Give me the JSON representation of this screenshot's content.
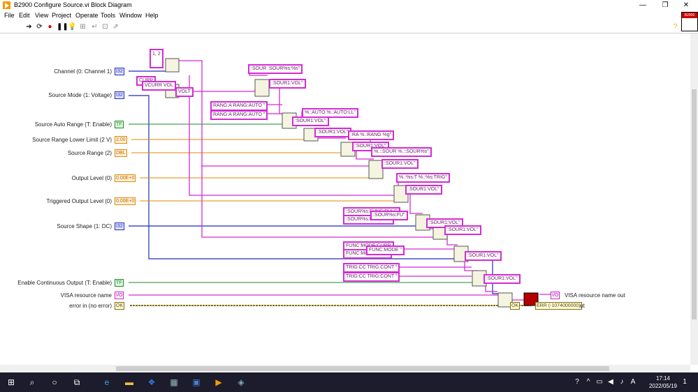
{
  "window": {
    "title": "B2900 Configure Source.vi Block Diagram",
    "minimize": "—",
    "maximize": "❐",
    "close": "✕"
  },
  "menu": [
    "File",
    "Edit",
    "View",
    "Project",
    "Operate",
    "Tools",
    "Window",
    "Help"
  ],
  "inputs": [
    {
      "label": "Channel (0: Channel 1)",
      "value": "I32",
      "color": "blue"
    },
    {
      "label": "Source Mode (1: Voltage)",
      "value": "I32",
      "color": "blue"
    },
    {
      "label": "Source Auto Range (T: Enable)",
      "value": "TF",
      "color": "green"
    },
    {
      "label": "Source Range Lower Limit (2 V)",
      "value": "2.00",
      "color": "orange"
    },
    {
      "label": "Source Range (2)",
      "value": "DBL",
      "color": "orange"
    },
    {
      "label": "Output Level (0)",
      "value": "0.00E+0",
      "color": "orange"
    },
    {
      "label": "Triggered Output Level (0)",
      "value": "0.00E+0",
      "color": "orange"
    },
    {
      "label": "Source Shape (1: DC)",
      "value": "I32",
      "color": "blue"
    },
    {
      "label": "Enable Continuous Output (T: Enable)",
      "value": "TF",
      "color": "green"
    },
    {
      "label": "VISA resource name",
      "value": "I/O",
      "color": "pink"
    },
    {
      "label": "error in (no error)",
      "value": "OK",
      "color": "yellow"
    }
  ],
  "consts": {
    "c12": "1, 2",
    "curr": "CURR",
    "vcurr": "VCURR VOL",
    "volt": "VOLT",
    "sour": ":SOUR :SOUR%s:%s\"",
    "sour1a": ":SOUR1:VOL\"",
    "rang1": "RANG:A RANG:AUTO \"",
    "rang2": "RANG:A RANG:AUTO \"",
    "auto": "%.:AUTO %.:AUTO:LL\"",
    "sour1b": ":SOUR1:VOL\"",
    "sour1c": ":SOUR1:VOL\"",
    "rangg": ":RA %.:RANG %g\"",
    "sour1d": ":SOUR1:VOL\"",
    "soursour": "%.::SOUR %.::SOUR%s\"",
    "sour1e": ":SOUR1:VOL\"",
    "trig": "%.:%s:T %.:%s:TRIG\"",
    "sour1f": ":SOUR1:VOL\"",
    "func1": ":SOUR%s:FUNC:PULS",
    "func2": ":SOUR%s:FUNC:DC",
    "funcf": ":SOUR%s:FU\"",
    "sour1g": ":SOUR1:VOL\"",
    "sour1h": ":SOUR1:VOL\"",
    "mode1": "FUNC:MODE:CURR",
    "mode2": "FUNC:MODE:VOLT",
    "modef": "FUNC:MODE \"",
    "sour1i": ":SOUR1:VOL\"",
    "trig1": "TRIG:CC TRIG:CONT \"",
    "trig2": "TRIG:CC TRIG:CONT \"",
    "sour1j": ":SOUR1:VOL\""
  },
  "outputs": {
    "visa_out_term": "I/O",
    "visa_out_label": "VISA resource name out",
    "err_term": "ERR (-1074000000)",
    "err_label": "ut",
    "ok": "OK"
  },
  "taskbar": {
    "time": "17:14",
    "date": "2022/05/19",
    "notif": "1"
  }
}
